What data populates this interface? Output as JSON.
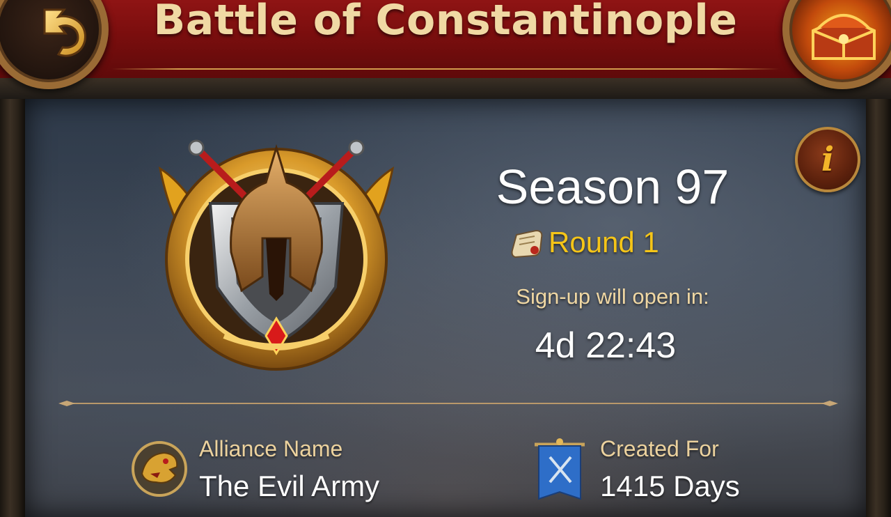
{
  "header": {
    "title": "Battle of Constantinople",
    "back_icon": "back-arrow-icon",
    "chest_icon": "treasure-chest-icon"
  },
  "event": {
    "season": "Season 97",
    "round": "Round 1",
    "signup_label": "Sign-up will open in:",
    "countdown": "4d 22:43",
    "info_label": "i"
  },
  "alliance": {
    "name_label": "Alliance Name",
    "name_value": "The Evil Army",
    "created_label": "Created For",
    "created_value": "1415 Days"
  },
  "colors": {
    "header_red": "#8f1414",
    "title_gold": "#f0d9a4",
    "round_yellow": "#f5c518",
    "label_cream": "#ecd29e"
  }
}
